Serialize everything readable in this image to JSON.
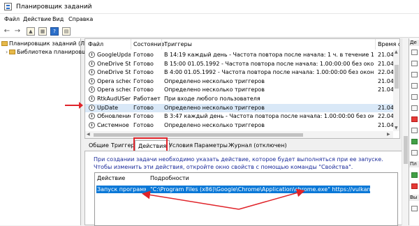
{
  "window": {
    "title": "Планировщик заданий"
  },
  "menu": [
    "Файл",
    "Действие",
    "Вид",
    "Справка"
  ],
  "tree": {
    "root": "Планировщик заданий (Лока",
    "child": "Библиотека планировщ"
  },
  "task_table": {
    "columns": [
      "Файл",
      "Состояние",
      "Триггеры",
      "Время следую"
    ],
    "rows": [
      {
        "name": "GoogleUpda...",
        "status": "Готово",
        "trigger": "В 14:19 каждый день - Частота повтора после начала: 1 ч. в течение 1 д.",
        "next": "21.04.2020 16:1"
      },
      {
        "name": "OneDrive Sta...",
        "status": "Готово",
        "trigger": "В 15:00 01.05.1992 - Частота повтора после начала: 1.00:00:00 без окончания.",
        "next": "21.04.2020 15:0"
      },
      {
        "name": "OneDrive Sta...",
        "status": "Готово",
        "trigger": "В 4:00 01.05.1992 - Частота повтора после начала: 1.00:00:00 без окончания.",
        "next": "22.04.2020 4:00"
      },
      {
        "name": "Opera sched...",
        "status": "Готово",
        "trigger": "Определено несколько триггеров",
        "next": "21.04.2020 16:1"
      },
      {
        "name": "Opera sched...",
        "status": "Готово",
        "trigger": "Определено несколько триггеров",
        "next": "21.04.2020 16:1"
      },
      {
        "name": "RtkAudUServ...",
        "status": "Работает",
        "trigger": "При входе любого пользователя",
        "next": ""
      },
      {
        "name": "UpDate",
        "status": "Готово",
        "trigger": "Определено несколько триггеров",
        "next": "21.04.2020 16:1"
      },
      {
        "name": "Обновление...",
        "status": "Готово",
        "trigger": "В 3:47 каждый день - Частота повтора после начала: 1.00:00:00 без окончания.",
        "next": "22.04.2020 3:47"
      },
      {
        "name": "Системное о...",
        "status": "Готово",
        "trigger": "Определено несколько триггеров",
        "next": "21.04.2020 16:0"
      }
    ]
  },
  "tabs": [
    "Общие",
    "Триггеры",
    "Действия",
    "Условия",
    "Параметры",
    "Журнал (отключен)"
  ],
  "details": {
    "description": "При создании задачи необходимо указать действие, которое будет выполняться при ее запуске. Чтобы изменить эти действия, откройте окно свойств с помощью команды \"Свойства\".",
    "columns": [
      "Действие",
      "Подробности"
    ],
    "action": {
      "type": "Запуск программы",
      "detail": "\"C:\\Program Files (x86)\\Google\\Chrome\\Application\\chrome.exe\" https://vulkan365.net.ua/"
    }
  },
  "action_panel": {
    "label_top": "Де",
    "label_mid": "Пл",
    "label_bottom": "Вы"
  },
  "colors": {
    "highlight": "#0a78d7",
    "annotation": "#e0242a"
  }
}
